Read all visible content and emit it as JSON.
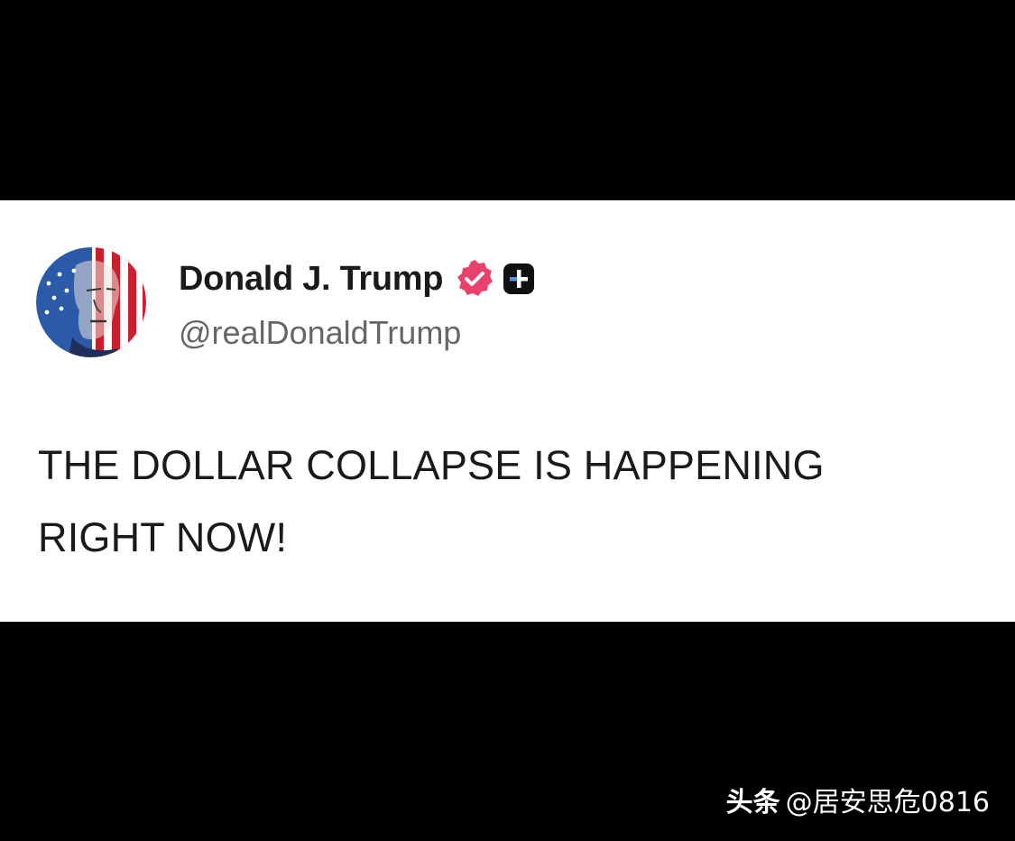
{
  "post": {
    "display_name": "Donald J. Trump",
    "handle": "@realDonaldTrump",
    "text_line_1": "THE DOLLAR COLLAPSE IS HAPPENING",
    "text_line_2": "RIGHT NOW!",
    "verified_icon": "verified-badge-icon",
    "plus_icon": "plus-badge-icon",
    "avatar_icon": "profile-avatar-flag"
  },
  "watermark": {
    "brand": "头条",
    "account": "@居安思危0816"
  },
  "colors": {
    "background": "#000000",
    "card": "#ffffff",
    "name_text": "#1a1a1a",
    "handle_text": "#666666",
    "verified_badge": "#e8416c",
    "plus_badge": "#111111",
    "flag_red": "#c8202e",
    "flag_blue": "#2b5aa8"
  }
}
